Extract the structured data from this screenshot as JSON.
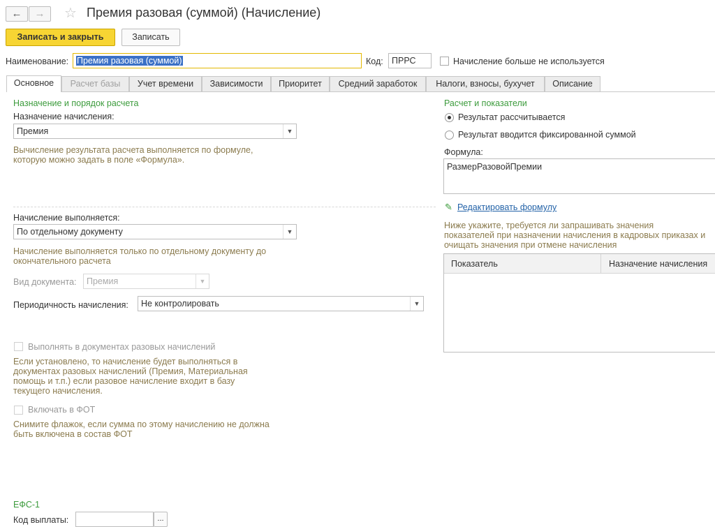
{
  "window": {
    "title": "Премия разовая (суммой) (Начисление)"
  },
  "nav": {
    "back": "←",
    "forward": "→",
    "star": "☆"
  },
  "toolbar": {
    "save_close": "Записать и закрыть",
    "save": "Записать"
  },
  "header": {
    "name_label": "Наименование:",
    "name_value": "Премия разовая (суммой)",
    "code_label": "Код:",
    "code_value": "ПРРС",
    "unused_label": "Начисление больше не используется"
  },
  "tabs": [
    {
      "label": "Основное"
    },
    {
      "label": "Расчет базы"
    },
    {
      "label": "Учет времени"
    },
    {
      "label": "Зависимости"
    },
    {
      "label": "Приоритет"
    },
    {
      "label": "Средний заработок"
    },
    {
      "label": "Налоги, взносы, бухучет"
    },
    {
      "label": "Описание"
    }
  ],
  "left": {
    "section_title": "Назначение и порядок расчета",
    "purpose_label": "Назначение начисления:",
    "purpose_value": "Премия",
    "purpose_hint_1": "Вычисление результата расчета выполняется по формуле,",
    "purpose_hint_2": "которую можно задать в поле «Формула».",
    "perform_label": "Начисление выполняется:",
    "perform_value": "По отдельному документу",
    "perform_hint_1": "Начисление выполняется только по отдельному документу до",
    "perform_hint_2": "окончательного расчета",
    "doctype_label": "Вид документа:",
    "doctype_value": "Премия",
    "period_label": "Периодичность начисления:",
    "period_value": "Не контролировать",
    "oneoff_label": "Выполнять в документах разовых начислений",
    "oneoff_hint_1": "Если установлено, то начисление будет выполняться в",
    "oneoff_hint_2": "документах разовых начислений (Премия, Материальная",
    "oneoff_hint_3": "помощь и т.п.) если разовое начисление входит в базу",
    "oneoff_hint_4": "текущего начисления.",
    "fot_label": "Включать в ФОТ",
    "fot_hint_1": "Снимите флажок, если сумма по этому начислению не должна",
    "fot_hint_2": "быть включена в состав ФОТ",
    "efs_title": "ЕФС-1",
    "pay_code_label": "Код выплаты:",
    "pay_code_value": "",
    "pay_code_btn": "..."
  },
  "right": {
    "section_title": "Расчет и показатели",
    "radio_calc": "Результат рассчитывается",
    "radio_fixed": "Результат вводится фиксированной суммой",
    "formula_label": "Формула:",
    "formula_value": "РазмерРазовойПремии",
    "edit_formula": "Редактировать формулу",
    "note_1": "Ниже укажите, требуется ли запрашивать значения",
    "note_2": "показателей при назначении начисления в кадровых приказах и",
    "note_3": "очищать значения при отмене начисления",
    "table_headers": [
      "Показатель",
      "Назначение начисления"
    ]
  }
}
